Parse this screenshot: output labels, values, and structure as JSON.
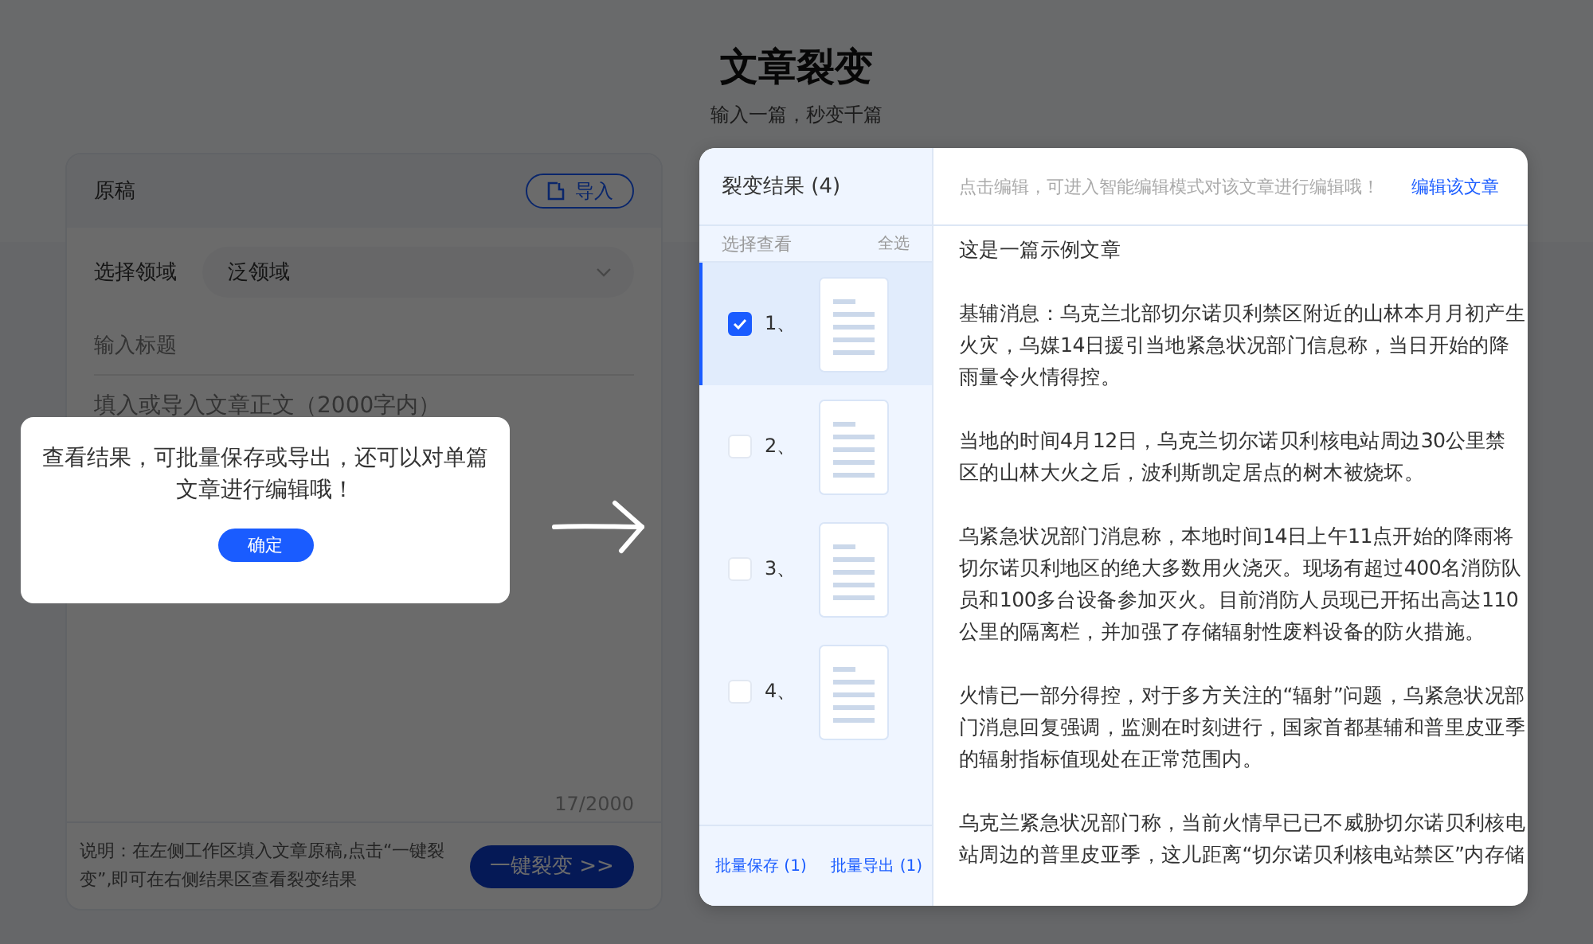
{
  "page": {
    "title": "文章裂变",
    "subtitle": "输入一篇，秒变千篇"
  },
  "source": {
    "title": "原稿",
    "import_button": "导入",
    "domain_label": "选择领域",
    "domain_value": "泛领域",
    "title_placeholder": "输入标题",
    "body_placeholder": "填入或导入文章正文（2000字内）",
    "counter": "17/2000",
    "note": "说明：在左侧工作区填入文章原稿,点击“一键裂变”,即可在右侧结果区查看裂变结果",
    "submit_button": "一键裂变 >>"
  },
  "results": {
    "title": "裂变结果 (4)",
    "list_label": "选择查看",
    "select_all": "全选",
    "items": [
      {
        "label": "1、",
        "checked": true,
        "selected": true
      },
      {
        "label": "2、",
        "checked": false,
        "selected": false
      },
      {
        "label": "3、",
        "checked": false,
        "selected": false
      },
      {
        "label": "4、",
        "checked": false,
        "selected": false
      }
    ],
    "save_button": "批量保存 (1)",
    "export_button": "批量导出 (1)",
    "hint": "点击编辑，可进入智能编辑模式对该文章进行编辑哦！",
    "edit_link": "编辑该文章",
    "article": [
      "这是一篇示例文章",
      "基辅消息：乌克兰北部切尔诺贝利禁区附近的山林本月月初产生火灾，乌媒14日援引当地紧急状况部门信息称，当日开始的降雨量令火情得控。",
      "当地的时间4月12日，乌克兰切尔诺贝利核电站周边30公里禁区的山林大火之后，波利斯凯定居点的树木被烧坏。",
      "乌紧急状况部门消息称，本地时间14日上午11点开始的降雨将切尔诺贝利地区的绝大多数用火浇灭。现场有超过400名消防队员和100多台设备参加灭火。目前消防人员现已开拓出高达110公里的隔离栏，并加强了存储辐射性废料设备的防火措施。",
      "火情已一部分得控，对于多方关注的“辐射”问题，乌紧急状况部门消息回复强调，监测在时刻进行，国家首都基辅和普里皮亚季的辐射指标值现处在正常范围内。",
      "乌克兰紧急状况部门称，当前火情早已已不威胁切尔诺贝利核电站周边的普里皮亚季，这儿距离“切尔诺贝利核电站禁区”内存储"
    ]
  },
  "guide": {
    "message": "查看结果，可批量保存或导出，还可以对单篇文章进行编辑哦！",
    "confirm_button": "确定"
  }
}
